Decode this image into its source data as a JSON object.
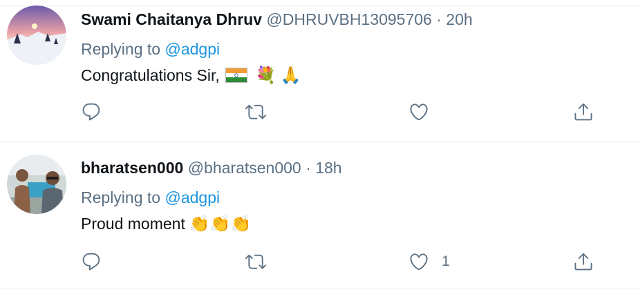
{
  "tweets": [
    {
      "display_name": "Swami Chaitanya Dhruv",
      "handle": "@DHRUVBH13095706",
      "separator": "·",
      "time": "20h",
      "replying_prefix": "Replying to",
      "replying_to": "@adgpi",
      "text": "Congratulations Sir,",
      "emoji": [
        "india-flag",
        "💐",
        "🙏"
      ],
      "like_count": ""
    },
    {
      "display_name": "bharatsen000",
      "handle": "@bharatsen000",
      "separator": "·",
      "time": "18h",
      "replying_prefix": "Replying to",
      "replying_to": "@adgpi",
      "text": "Proud moment",
      "emoji_text": "👏👏👏",
      "like_count": "1"
    }
  ],
  "colors": {
    "text": "#0f1419",
    "muted": "#5b7083",
    "link": "#1b95e0",
    "divider": "#e6ecf0"
  },
  "icons": [
    "reply-icon",
    "retweet-icon",
    "like-icon",
    "share-icon"
  ]
}
